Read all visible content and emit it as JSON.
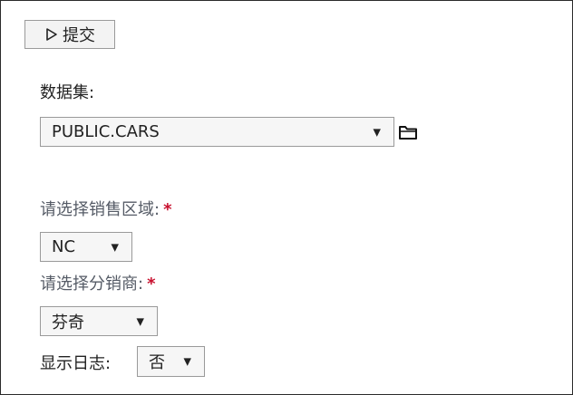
{
  "toolbar": {
    "submit_label": "提交",
    "submit_icon": "play-outline-icon"
  },
  "dataset": {
    "label": "数据集:",
    "value": "PUBLIC.CARS",
    "browse_icon": "folder-icon"
  },
  "region": {
    "label": "请选择销售区域:",
    "required_mark": "*",
    "value": "NC"
  },
  "distributor": {
    "label": "请选择分销商:",
    "required_mark": "*",
    "value": "芬奇"
  },
  "show_log": {
    "label": "显示日志:",
    "value": "否"
  },
  "colors": {
    "required": "#c8102e",
    "muted_label": "#555b66",
    "border": "#9a9a9a",
    "field_bg": "#f6f6f6"
  }
}
